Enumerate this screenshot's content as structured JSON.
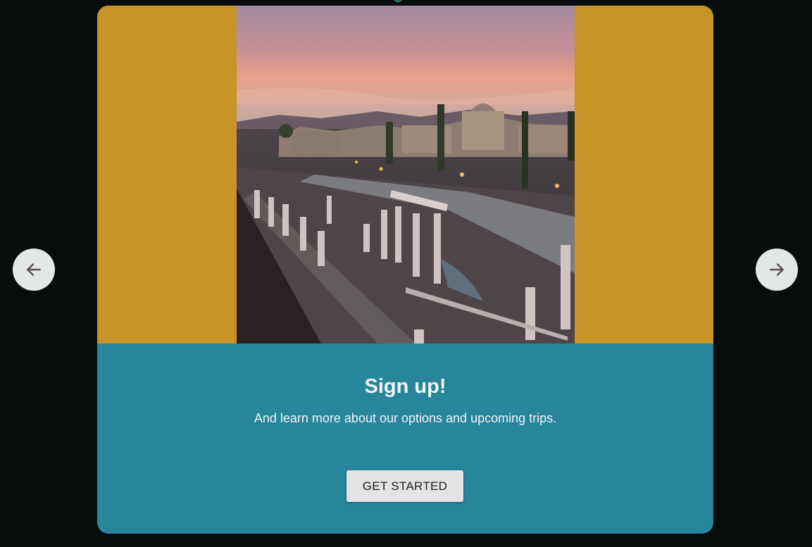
{
  "slide": {
    "title": "Sign up!",
    "subtitle": "And learn more about our options and upcoming trips.",
    "cta_label": "GET STARTED",
    "image_subject": "ancient ruins at dusk"
  },
  "navigation": {
    "prev_icon": "arrow-left-icon",
    "next_icon": "arrow-right-icon"
  },
  "colors": {
    "page_background": "#070c0d",
    "media_background": "#c79428",
    "content_background": "#27859c",
    "button_background": "#e3e5e4",
    "nav_button_background": "#e3e7e6",
    "nav_arrow": "#5a4a4e"
  }
}
